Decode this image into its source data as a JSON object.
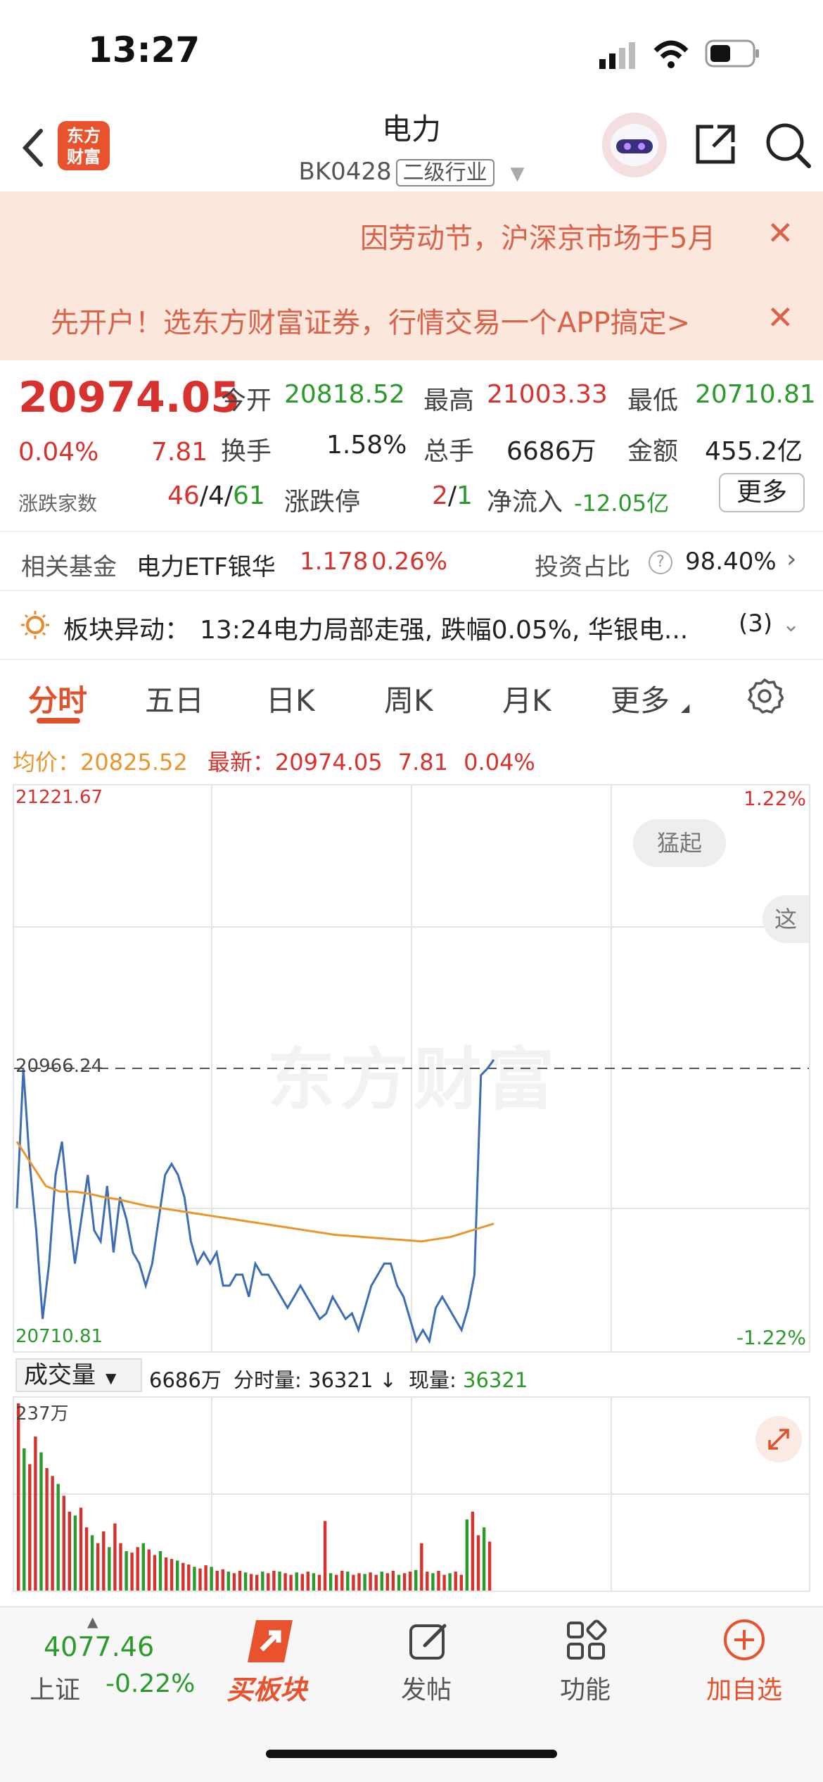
{
  "status": {
    "time": "13:27"
  },
  "nav": {
    "title": "电力",
    "code": "BK0428",
    "tag": "二级行业",
    "logo_text": "东方财富"
  },
  "banner": {
    "line1": "因劳动节，沪深京市场于5月",
    "line2": "先开户！选东方财富证券，行情交易一个APP搞定>"
  },
  "quote": {
    "price": "20974.05",
    "pct": "0.04%",
    "change": "7.81",
    "open_label": "今开",
    "open": "20818.52",
    "high_label": "最高",
    "high": "21003.33",
    "low_label": "最低",
    "low": "20710.81",
    "turnover_label": "换手",
    "turnover": "1.58%",
    "volume_label": "总手",
    "volume": "6686万",
    "amount_label": "金额",
    "amount": "455.2亿",
    "breadth_label": "涨跌家数",
    "up": "46",
    "flat": "4",
    "down": "61",
    "limit_label": "涨跌停",
    "limit_up": "2",
    "limit_down": "1",
    "netflow_label": "净流入",
    "netflow": "-12.05亿",
    "more_label": "更多"
  },
  "fund": {
    "label": "相关基金",
    "name": "电力ETF银华",
    "price": "1.178",
    "pct": "0.26%",
    "ratio_label": "投资占比",
    "ratio": "98.40%"
  },
  "alert": {
    "label": "板块异动：",
    "text": "13:24电力局部走强, 跌幅0.05%, 华银电...",
    "count": "(3)"
  },
  "tabs": [
    "分时",
    "五日",
    "日K",
    "周K",
    "月K",
    "更多"
  ],
  "chart_info": {
    "avg_label": "均价：",
    "avg": "20825.52",
    "latest_label": "最新：",
    "latest": "20974.05",
    "chg": "7.81",
    "pct": "0.04%"
  },
  "chart_data": {
    "type": "line",
    "y_top": "21221.67",
    "y_bottom": "20710.81",
    "y_ref": "20966.24",
    "pct_top": "1.22%",
    "pct_bottom": "-1.22%",
    "ylim": [
      20710.81,
      21221.67
    ],
    "series": [
      {
        "values": [
          20840,
          20966,
          20880,
          20820,
          20740,
          20790,
          20870,
          20900,
          20840,
          20790,
          20830,
          20870,
          20820,
          20810,
          20860,
          20800,
          20850,
          20830,
          20800,
          20790,
          20770,
          20790,
          20830,
          20870,
          20880,
          20870,
          20850,
          20810,
          20790,
          20800,
          20790,
          20800,
          20770,
          20770,
          20780,
          20780,
          20760,
          20790,
          20780,
          20780,
          20770,
          20760,
          20750,
          20760,
          20770,
          20760,
          20750,
          20740,
          20745,
          20760,
          20750,
          20740,
          20745,
          20730,
          20750,
          20770,
          20780,
          20790,
          20790,
          20770,
          20760,
          20740,
          20720,
          20730,
          20720,
          20750,
          20760,
          20750,
          20740,
          20730,
          20750,
          20780,
          20960,
          20966,
          20974
        ]
      },
      {
        "values": [
          20900,
          20880,
          20860,
          20855,
          20855,
          20853,
          20850,
          20848,
          20845,
          20842,
          20840,
          20838,
          20836,
          20834,
          20832,
          20830,
          20828,
          20826,
          20824,
          20822,
          20820,
          20818,
          20816,
          20815,
          20814,
          20813,
          20812,
          20811,
          20810,
          20812,
          20814,
          20818,
          20822,
          20826
        ]
      }
    ]
  },
  "badges": {
    "surge": "猛起",
    "partial": "这"
  },
  "volume": {
    "selector": "成交量",
    "total": "6686万",
    "tick_label": "分时量: 36321",
    "now_label": "现量: ",
    "now": "36321",
    "ymax": "237万",
    "arrow": "↓"
  },
  "volume_data": [
    237,
    180,
    160,
    195,
    175,
    155,
    145,
    135,
    120,
    100,
    95,
    105,
    80,
    70,
    60,
    75,
    55,
    85,
    60,
    50,
    48,
    55,
    60,
    52,
    45,
    50,
    42,
    40,
    38,
    35,
    33,
    30,
    28,
    32,
    30,
    25,
    27,
    24,
    22,
    25,
    23,
    21,
    20,
    24,
    22,
    25,
    24,
    22,
    20,
    23,
    21,
    24,
    22,
    20,
    88,
    22,
    20,
    25,
    24,
    20,
    22,
    21,
    23,
    20,
    24,
    22,
    25,
    20,
    22,
    24,
    26,
    60,
    24,
    22,
    25,
    20,
    22,
    24,
    20,
    90,
    100,
    70,
    80,
    62
  ],
  "bottom": {
    "index_value": "4077.46",
    "index_name": "上证",
    "index_pct": "-0.22%",
    "buy_label": "买板块",
    "post_label": "发帖",
    "func_label": "功能",
    "add_label": "加自选"
  }
}
